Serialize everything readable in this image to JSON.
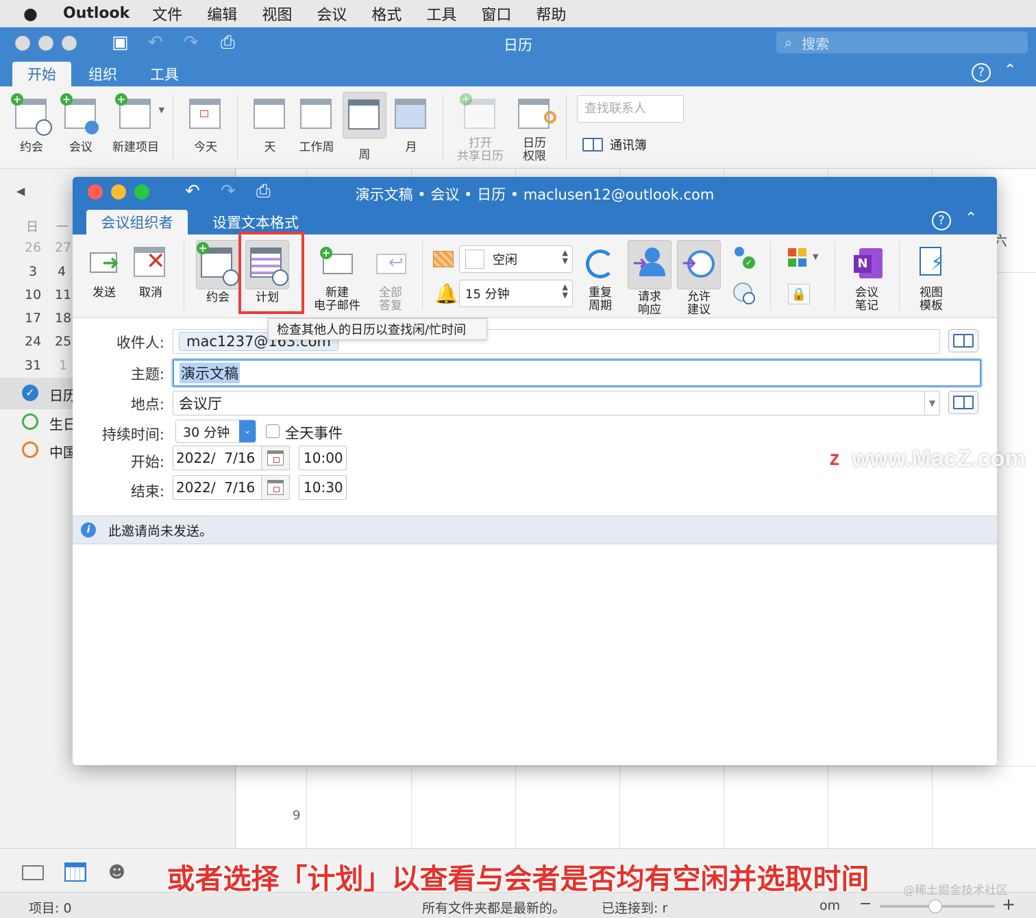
{
  "menubar": {
    "apple": "",
    "app_name": "Outlook",
    "items": [
      "文件",
      "编辑",
      "视图",
      "会议",
      "格式",
      "工具",
      "窗口",
      "帮助"
    ]
  },
  "main_window": {
    "title": "日历",
    "search_placeholder": "搜索",
    "tabs": [
      "开始",
      "组织",
      "工具"
    ],
    "active_tab": "开始",
    "ribbon": {
      "appointment": "约会",
      "meeting": "会议",
      "new_item": "新建项目",
      "today": "今天",
      "day": "天",
      "work_week": "工作周",
      "week": "周",
      "month": "月",
      "open_shared_1": "打开",
      "open_shared_2": "共享日历",
      "cal_perm_1": "日历",
      "cal_perm_2": "权限",
      "find_contact_placeholder": "查找联系人",
      "address_book": "通讯簿"
    }
  },
  "sidebar": {
    "nav_arrow": "◀",
    "weekday_headers": [
      "日",
      "一"
    ],
    "weeks": [
      [
        "26",
        "27"
      ],
      [
        "3",
        "4"
      ],
      [
        "10",
        "11"
      ],
      [
        "17",
        "18"
      ],
      [
        "24",
        "25"
      ],
      [
        "31",
        "1"
      ]
    ],
    "calendars": [
      {
        "label": "日历",
        "color": "#2f7fd0",
        "checked": true
      },
      {
        "label": "生日",
        "color": "#3cb34a",
        "checked": false
      },
      {
        "label": "中国",
        "color": "#ef7d22",
        "checked": false
      }
    ]
  },
  "calendar_grid": {
    "hour_label": "9",
    "right_header_fragment": "六"
  },
  "dialog": {
    "title": "演示文稿 • 会议 • 日历 • maclusen12@outlook.com",
    "tabs": [
      "会议组织者",
      "设置文本格式"
    ],
    "active_tab": "会议组织者",
    "ribbon": {
      "send": "发送",
      "cancel": "取消",
      "appointment": "约会",
      "schedule": "计划",
      "new_email_1": "新建",
      "new_email_2": "电子邮件",
      "reply_all_1": "全部",
      "reply_all_2": "答复",
      "show_as": "空闲",
      "reminder": "15 分钟",
      "recurrence_1": "重复",
      "recurrence_2": "周期",
      "request_resp_1": "请求",
      "request_resp_2": "响应",
      "allow_prop_1": "允许",
      "allow_prop_2": "建议",
      "meeting_notes_1": "会议",
      "meeting_notes_2": "笔记",
      "view_templates_1": "视图",
      "view_templates_2": "模板"
    },
    "tooltip": "检查其他人的日历以查找闲/忙时间",
    "form": {
      "to_label": "收件人:",
      "to_value": "mac1237@163.com",
      "subject_label": "主题:",
      "subject_value": "演示文稿",
      "location_label": "地点:",
      "location_value": "会议厅",
      "duration_label": "持续时间:",
      "duration_value": "30 分钟",
      "all_day_label": "全天事件",
      "start_label": "开始:",
      "start_date": "2022/  7/16",
      "start_time": "10:00",
      "end_label": "结束:",
      "end_date": "2022/  7/16",
      "end_time": "10:30"
    },
    "info_message": "此邀请尚未发送。"
  },
  "status_bar": {
    "items_count": "项目: 0",
    "sync_status": "所有文件夹都是最新的。",
    "connected": "已连接到: r",
    "connected_tail": "om"
  },
  "watermark": "www.MacZ.com",
  "watermark_logo": "Z",
  "caption": "或者选择「计划」以查看与会者是否均有空闲并选取时间",
  "credit": "@稀土掘金技术社区"
}
